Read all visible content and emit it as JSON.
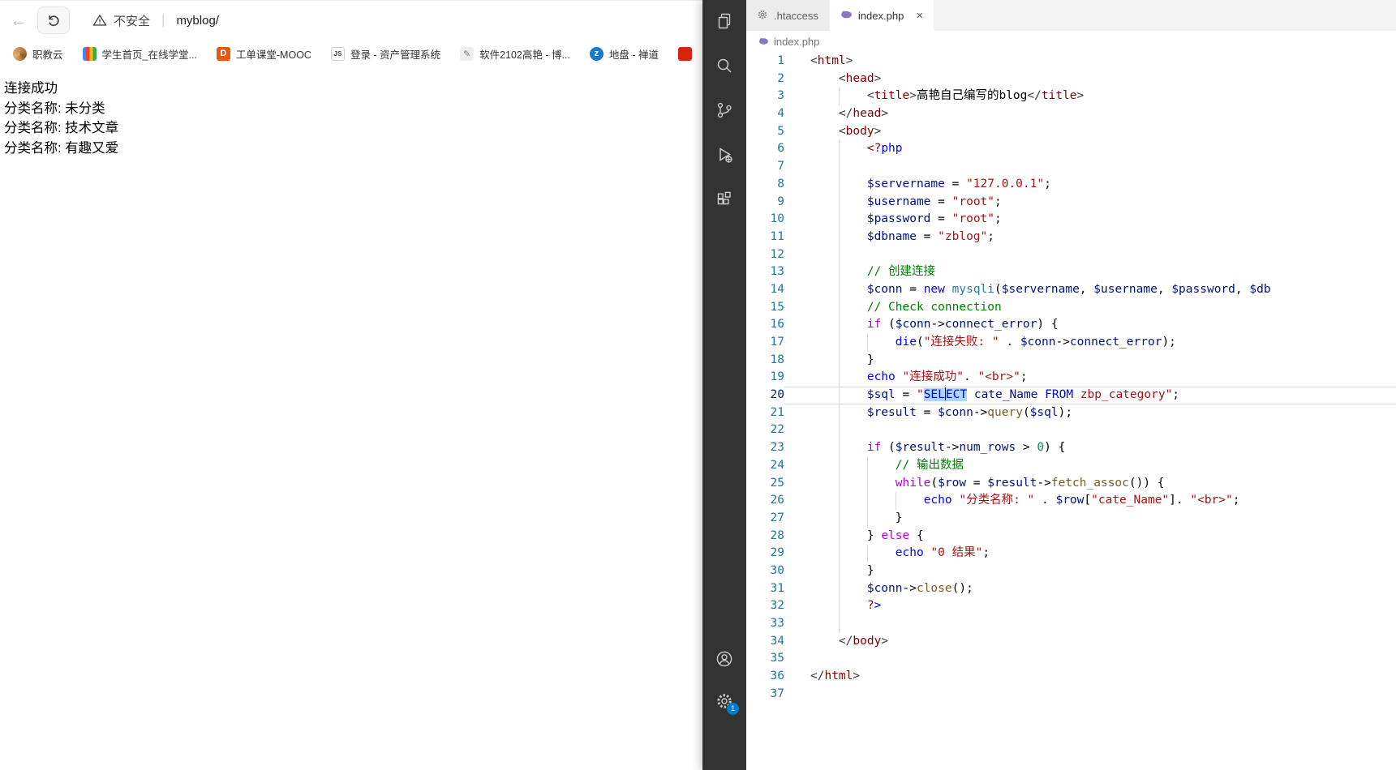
{
  "browser": {
    "toolbar": {
      "back_icon": "arrow-left-icon",
      "refresh_icon": "refresh-icon",
      "warning_icon": "warning-triangle-icon",
      "security_label": "不安全",
      "separator": "|",
      "url": "myblog/"
    },
    "bookmarks": [
      {
        "label": "职教云",
        "icon": "zhijiaoyun-favicon",
        "text": ""
      },
      {
        "label": "学生首页_在线学堂...",
        "icon": "xuetang-favicon",
        "text": ""
      },
      {
        "label": "工单课堂-MOOC",
        "icon": "mooc-favicon",
        "text": "D"
      },
      {
        "label": "登录 - 资产管理系统",
        "icon": "asset-favicon",
        "text": "JS"
      },
      {
        "label": "软件2102高艳 - 博...",
        "icon": "blog-favicon",
        "text": "✎"
      },
      {
        "label": "地盘 - 禅道",
        "icon": "zentao-favicon",
        "text": "z"
      },
      {
        "label": "",
        "icon": "clipped-favicon",
        "text": ""
      }
    ],
    "page_lines": [
      "连接成功",
      "分类名称: 未分类",
      "分类名称: 技术文章",
      "分类名称: 有趣又爱"
    ]
  },
  "editor": {
    "activity_bar": {
      "icons": [
        "files-icon",
        "search-icon",
        "source-control-icon",
        "run-debug-icon",
        "extensions-icon"
      ],
      "bottom_icons": [
        "account-icon",
        "settings-gear-icon"
      ],
      "settings_badge": "1"
    },
    "tabs": [
      {
        "label": ".htaccess",
        "icon": "gear-file-icon",
        "active": false
      },
      {
        "label": "index.php",
        "icon": "php-file-icon",
        "active": true,
        "close": "×"
      }
    ],
    "breadcrumb": {
      "icon": "php-file-icon",
      "label": "index.php"
    },
    "code": {
      "language": "php",
      "current_line": 20,
      "lines": [
        {
          "n": 1,
          "i": 0,
          "t": [
            [
              "ab",
              "<"
            ],
            [
              "tag",
              "html"
            ],
            [
              "ab",
              ">"
            ]
          ]
        },
        {
          "n": 2,
          "i": 1,
          "t": [
            [
              "ab",
              "<"
            ],
            [
              "tag",
              "head"
            ],
            [
              "ab",
              ">"
            ]
          ]
        },
        {
          "n": 3,
          "i": 2,
          "t": [
            [
              "ab",
              "<"
            ],
            [
              "tag",
              "title"
            ],
            [
              "ab",
              ">"
            ],
            [
              "pl",
              "高艳自己编写的blog"
            ],
            [
              "ab",
              "</"
            ],
            [
              "tag",
              "title"
            ],
            [
              "ab",
              ">"
            ]
          ]
        },
        {
          "n": 4,
          "i": 1,
          "t": [
            [
              "ab",
              "</"
            ],
            [
              "tag",
              "head"
            ],
            [
              "ab",
              ">"
            ]
          ]
        },
        {
          "n": 5,
          "i": 1,
          "t": [
            [
              "ab",
              "<"
            ],
            [
              "tag",
              "body"
            ],
            [
              "ab",
              ">"
            ]
          ]
        },
        {
          "n": 6,
          "i": 2,
          "t": [
            [
              "tag",
              "<?"
            ],
            [
              "kw",
              "php"
            ]
          ]
        },
        {
          "n": 7,
          "i": 2,
          "t": []
        },
        {
          "n": 8,
          "i": 2,
          "t": [
            [
              "var",
              "$servername"
            ],
            [
              "pl",
              " = "
            ],
            [
              "str",
              "\"127.0.0.1\""
            ],
            [
              "pl",
              ";"
            ]
          ]
        },
        {
          "n": 9,
          "i": 2,
          "t": [
            [
              "var",
              "$username"
            ],
            [
              "pl",
              " = "
            ],
            [
              "str",
              "\"root\""
            ],
            [
              "pl",
              ";"
            ]
          ]
        },
        {
          "n": 10,
          "i": 2,
          "t": [
            [
              "var",
              "$password"
            ],
            [
              "pl",
              " = "
            ],
            [
              "str",
              "\"root\""
            ],
            [
              "pl",
              ";"
            ]
          ]
        },
        {
          "n": 11,
          "i": 2,
          "t": [
            [
              "var",
              "$dbname"
            ],
            [
              "pl",
              " = "
            ],
            [
              "str",
              "\"zblog\""
            ],
            [
              "pl",
              ";"
            ]
          ]
        },
        {
          "n": 12,
          "i": 2,
          "t": []
        },
        {
          "n": 13,
          "i": 2,
          "t": [
            [
              "cm",
              "// 创建连接"
            ]
          ]
        },
        {
          "n": 14,
          "i": 2,
          "t": [
            [
              "var",
              "$conn"
            ],
            [
              "pl",
              " = "
            ],
            [
              "kw",
              "new"
            ],
            [
              "pl",
              " "
            ],
            [
              "cls",
              "mysqli"
            ],
            [
              "pl",
              "("
            ],
            [
              "var",
              "$servername"
            ],
            [
              "pl",
              ", "
            ],
            [
              "var",
              "$username"
            ],
            [
              "pl",
              ", "
            ],
            [
              "var",
              "$password"
            ],
            [
              "pl",
              ", "
            ],
            [
              "var",
              "$db"
            ]
          ]
        },
        {
          "n": 15,
          "i": 2,
          "t": [
            [
              "cm",
              "// Check connection"
            ]
          ]
        },
        {
          "n": 16,
          "i": 2,
          "t": [
            [
              "ctrl",
              "if"
            ],
            [
              "pl",
              " ("
            ],
            [
              "var",
              "$conn"
            ],
            [
              "pl",
              "->"
            ],
            [
              "prop",
              "connect_error"
            ],
            [
              "pl",
              ") {"
            ]
          ]
        },
        {
          "n": 17,
          "i": 3,
          "t": [
            [
              "kw",
              "die"
            ],
            [
              "pl",
              "("
            ],
            [
              "str",
              "\"连接失败: \""
            ],
            [
              "pl",
              " . "
            ],
            [
              "var",
              "$conn"
            ],
            [
              "pl",
              "->"
            ],
            [
              "prop",
              "connect_error"
            ],
            [
              "pl",
              ");"
            ]
          ]
        },
        {
          "n": 18,
          "i": 2,
          "t": [
            [
              "pl",
              "}"
            ]
          ]
        },
        {
          "n": 19,
          "i": 2,
          "t": [
            [
              "kw",
              "echo"
            ],
            [
              "pl",
              " "
            ],
            [
              "str",
              "\"连接成功\""
            ],
            [
              "pl",
              ". "
            ],
            [
              "str",
              "\"<br>\""
            ],
            [
              "pl",
              ";"
            ]
          ]
        },
        {
          "n": 20,
          "i": 2,
          "c": true,
          "t": [
            [
              "var",
              "$sql"
            ],
            [
              "pl",
              " = "
            ],
            [
              "str",
              "\""
            ],
            [
              "sqlkw sel",
              "SEL"
            ],
            [
              "cursor",
              ""
            ],
            [
              "sqlkw sel",
              "ECT"
            ],
            [
              "str",
              " "
            ],
            [
              "sqlid",
              "cate_Name"
            ],
            [
              "str",
              " "
            ],
            [
              "sqlkw",
              "FROM"
            ],
            [
              "str",
              " zbp_category\""
            ],
            [
              "pl",
              ";"
            ]
          ]
        },
        {
          "n": 21,
          "i": 2,
          "t": [
            [
              "var",
              "$result"
            ],
            [
              "pl",
              " = "
            ],
            [
              "var",
              "$conn"
            ],
            [
              "pl",
              "->"
            ],
            [
              "fn",
              "query"
            ],
            [
              "pl",
              "("
            ],
            [
              "var",
              "$sql"
            ],
            [
              "pl",
              ");"
            ]
          ]
        },
        {
          "n": 22,
          "i": 2,
          "t": []
        },
        {
          "n": 23,
          "i": 2,
          "t": [
            [
              "ctrl",
              "if"
            ],
            [
              "pl",
              " ("
            ],
            [
              "var",
              "$result"
            ],
            [
              "pl",
              "->"
            ],
            [
              "prop",
              "num_rows"
            ],
            [
              "pl",
              " > "
            ],
            [
              "num",
              "0"
            ],
            [
              "pl",
              ") {"
            ]
          ]
        },
        {
          "n": 24,
          "i": 3,
          "t": [
            [
              "cm",
              "// 输出数据"
            ]
          ]
        },
        {
          "n": 25,
          "i": 3,
          "t": [
            [
              "ctrl",
              "while"
            ],
            [
              "pl",
              "("
            ],
            [
              "var",
              "$row"
            ],
            [
              "pl",
              " = "
            ],
            [
              "var",
              "$result"
            ],
            [
              "pl",
              "->"
            ],
            [
              "fn",
              "fetch_assoc"
            ],
            [
              "pl",
              "()) {"
            ]
          ]
        },
        {
          "n": 26,
          "i": 4,
          "t": [
            [
              "kw",
              "echo"
            ],
            [
              "pl",
              " "
            ],
            [
              "str",
              "\"分类名称: \""
            ],
            [
              "pl",
              " . "
            ],
            [
              "var",
              "$row"
            ],
            [
              "pl",
              "["
            ],
            [
              "str",
              "\"cate_Name\""
            ],
            [
              "pl",
              "]. "
            ],
            [
              "str",
              "\"<br>\""
            ],
            [
              "pl",
              ";"
            ]
          ]
        },
        {
          "n": 27,
          "i": 3,
          "t": [
            [
              "pl",
              "}"
            ]
          ]
        },
        {
          "n": 28,
          "i": 2,
          "t": [
            [
              "pl",
              "} "
            ],
            [
              "ctrl",
              "else"
            ],
            [
              "pl",
              " {"
            ]
          ]
        },
        {
          "n": 29,
          "i": 3,
          "t": [
            [
              "kw",
              "echo"
            ],
            [
              "pl",
              " "
            ],
            [
              "str",
              "\"0 结果\""
            ],
            [
              "pl",
              ";"
            ]
          ]
        },
        {
          "n": 30,
          "i": 2,
          "t": [
            [
              "pl",
              "}"
            ]
          ]
        },
        {
          "n": 31,
          "i": 2,
          "t": [
            [
              "var",
              "$conn"
            ],
            [
              "pl",
              "->"
            ],
            [
              "fn",
              "close"
            ],
            [
              "pl",
              "();"
            ]
          ]
        },
        {
          "n": 32,
          "i": 2,
          "t": [
            [
              "tag",
              "?"
            ],
            [
              "kw",
              ">"
            ]
          ]
        },
        {
          "n": 33,
          "i": 2,
          "t": []
        },
        {
          "n": 34,
          "i": 1,
          "t": [
            [
              "ab",
              "</"
            ],
            [
              "tag",
              "body"
            ],
            [
              "ab",
              ">"
            ]
          ]
        },
        {
          "n": 35,
          "i": 0,
          "t": []
        },
        {
          "n": 36,
          "i": 0,
          "t": [
            [
              "ab",
              "</"
            ],
            [
              "tag",
              "html"
            ],
            [
              "ab",
              ">"
            ]
          ]
        },
        {
          "n": 37,
          "i": 0,
          "t": []
        }
      ]
    }
  }
}
